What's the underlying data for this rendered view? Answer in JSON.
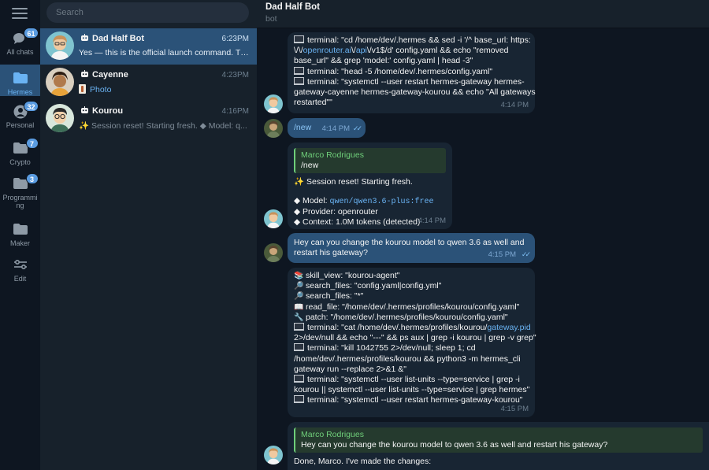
{
  "rail": {
    "folders": [
      {
        "label": "All chats",
        "badge": "61",
        "icon": "chat-bubbles-icon"
      },
      {
        "label": "Hermes",
        "badge": "",
        "icon": "folder-icon"
      },
      {
        "label": "Personal",
        "badge": "32",
        "icon": "person-icon"
      },
      {
        "label": "Crypto",
        "badge": "7",
        "icon": "folder-icon"
      },
      {
        "label": "Programming",
        "badge": "3",
        "icon": "folder-icon"
      },
      {
        "label": "Maker",
        "badge": "",
        "icon": "folder-icon"
      },
      {
        "label": "Edit",
        "badge": "",
        "icon": "sliders-icon"
      }
    ]
  },
  "search": {
    "placeholder": "Search"
  },
  "chats": [
    {
      "name": "Dad Half Bot",
      "time": "6:23PM",
      "preview": "Yes — this is the official launch command. The ...",
      "active": true
    },
    {
      "name": "Cayenne",
      "time": "4:23PM",
      "preview": "Photo"
    },
    {
      "name": "Kourou",
      "time": "4:16PM",
      "preview": "✨ Session reset! Starting fresh. ◆ Model: q..."
    }
  ],
  "header": {
    "title": "Dad Half Bot",
    "subtitle": "bot"
  },
  "messages": {
    "m1": {
      "lines": [
        "terminal: \"cd /home/dev/.hermes && sed -i '/^ base_url: https:",
        "\\/\\/",
        "openrouter.ai",
        "\\/",
        "api",
        "\\/v1$/d' config.yaml && echo \"removed",
        "base_url\" && grep 'model:' config.yaml | head -3\"",
        "terminal: \"head -5 /home/dev/.hermes/config.yaml\"",
        "terminal: \"systemctl --user restart hermes-gateway hermes-",
        "gateway-cayenne hermes-gateway-kourou && echo \"All gateways",
        "restarted\"\""
      ],
      "time": "4:14 PM"
    },
    "m2": {
      "text": "/new",
      "time": "4:14 PM"
    },
    "m3": {
      "quote_name": "Marco Rodrigues",
      "quote_text": "/new",
      "l1": "✨ Session reset! Starting fresh.",
      "model_label": "◆ Model: ",
      "model_value": "qwen/qwen3.6-plus:free",
      "provider": "◆ Provider: openrouter",
      "context": "◆ Context: 1.0M tokens (detected)",
      "time": "4:14 PM"
    },
    "m4": {
      "l1": "Hey can you change the kourou model to  qwen 3.6 as well and",
      "l2": "restart his gateway?",
      "time": "4:15 PM"
    },
    "m5": {
      "lines": [
        "skill_view: \"kourou-agent\"",
        "search_files: \"config.yaml|config.yml\"",
        "search_files: \"*\"",
        "read_file: \"/home/dev/.hermes/profiles/kourou/config.yaml\"",
        "patch: \"/home/dev/.hermes/profiles/kourou/config.yaml\"",
        "terminal: \"cat /home/dev/.hermes/profiles/kourou/",
        "gateway.pid",
        "2>/dev/null && echo \"---\" && ps aux | grep -i kourou | grep -v grep\"",
        "terminal: \"kill 1042755 2>/dev/null; sleep 1; cd",
        "/home/dev/.hermes/profiles/kourou && python3 -m hermes_cli",
        "gateway run --replace 2>&1 &\"",
        "terminal: \"systemctl --user list-units --type=service | grep -i",
        "kourou || systemctl --user list-units --type=service | grep hermes\"",
        "terminal: \"systemctl --user restart hermes-gateway-kourou\""
      ],
      "time": "4:15 PM"
    },
    "m6": {
      "quote_name": "Marco Rodrigues",
      "quote_text": "Hey can you change the kourou model to  qwen 3.6 as well and restart his gateway?",
      "text": "Done, Marco. I've made the changes:"
    }
  }
}
